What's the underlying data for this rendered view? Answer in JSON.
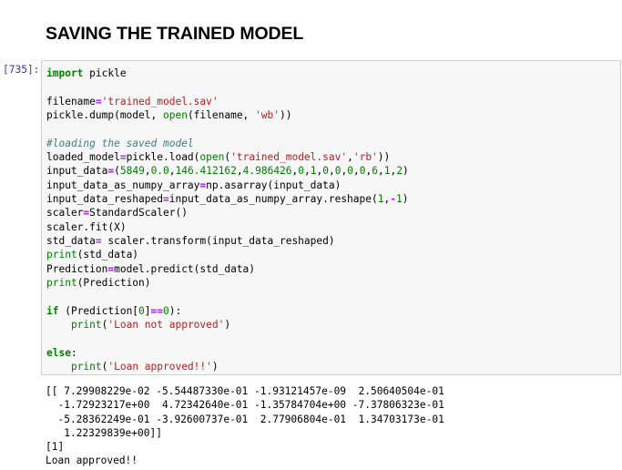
{
  "section": {
    "title": "SAVING THE TRAINED MODEL"
  },
  "cell": {
    "prompt": "[735]:",
    "lines": [
      "import pickle",
      "",
      "filename='trained_model.sav'",
      "pickle.dump(model, open(filename, 'wb'))",
      "",
      "#loading the saved model",
      "loaded_model=pickle.load(open('trained_model.sav','rb'))",
      "input_data=(5849,0.0,146.412162,4.986426,0,1,0,0,0,0,6,1,2)",
      "input_data_as_numpy_array=np.asarray(input_data)",
      "input_data_reshaped=input_data_as_numpy_array.reshape(1,-1)",
      "scaler=StandardScaler()",
      "scaler.fit(X)",
      "std_data= scaler.transform(input_data_reshaped)",
      "print(std_data)",
      "Prediction=model.predict(std_data)",
      "print(Prediction)",
      "",
      "if (Prediction[0]==0):",
      "    print('Loan not approved')",
      "",
      "else:",
      "    print('Loan approved!!')"
    ]
  },
  "output": {
    "lines": [
      "[[ 7.29908229e-02 -5.54487330e-01 -1.93121457e-09  2.50640504e-01",
      "  -1.72923217e+00  4.72342640e-01 -1.35784704e+00 -7.37806323e-01",
      "  -5.28362249e-01 -3.92600737e-01  2.77906804e-01  1.34703173e-01",
      "   1.22329839e+00]]",
      "[1]",
      "Loan approved!!"
    ]
  }
}
